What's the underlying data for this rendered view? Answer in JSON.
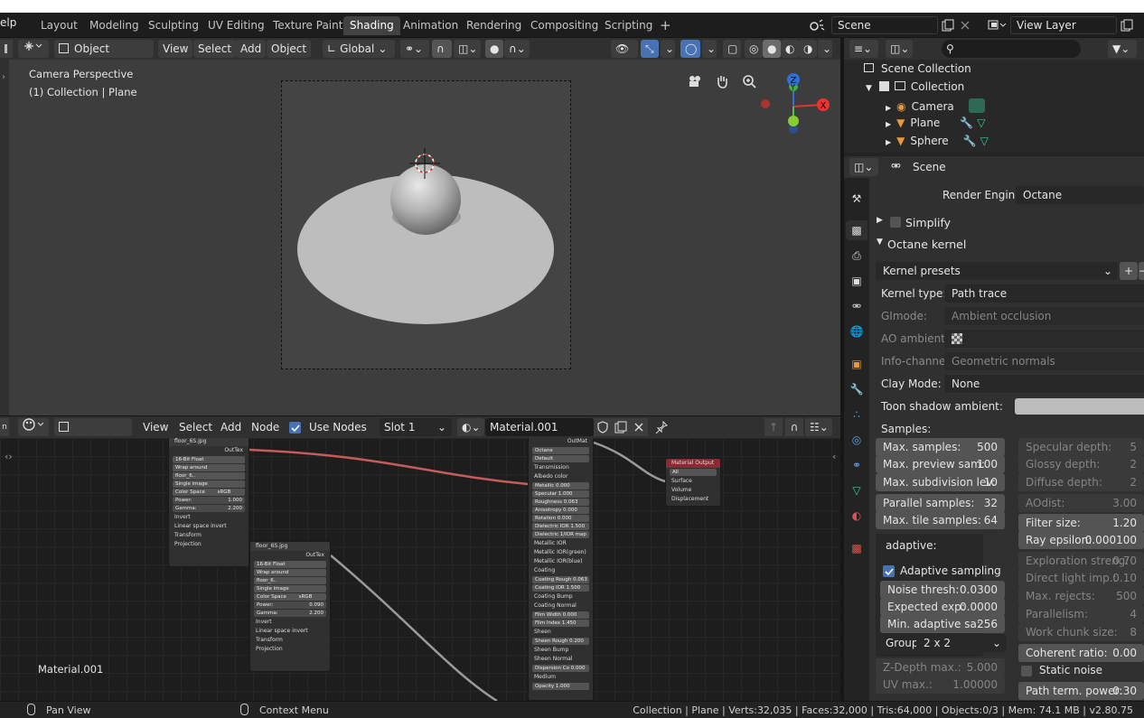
{
  "top_menu": {
    "help_fragment": "elp"
  },
  "workspace_tabs": [
    {
      "label": "Layout"
    },
    {
      "label": "Modeling"
    },
    {
      "label": "Sculpting"
    },
    {
      "label": "UV Editing"
    },
    {
      "label": "Texture Paint"
    },
    {
      "label": "Shading",
      "active": true
    },
    {
      "label": "Animation"
    },
    {
      "label": "Rendering"
    },
    {
      "label": "Compositing"
    },
    {
      "label": "Scripting"
    }
  ],
  "add_tab": "+",
  "scene_selector": {
    "value": "Scene"
  },
  "view_layer": {
    "value": "View Layer"
  },
  "viewport": {
    "mode": "Object Mode",
    "menus": [
      "View",
      "Select",
      "Add",
      "Object"
    ],
    "transform": "Global",
    "overlay_text_1": "Camera Perspective",
    "overlay_text_2": "(1) Collection | Plane",
    "gizmo_axis_z": "Z",
    "gizmo_axis_y": "Y",
    "gizmo_axis_x": "X"
  },
  "node_editor": {
    "type": "Object",
    "menus": [
      "View",
      "Select",
      "Add",
      "Node"
    ],
    "use_nodes_label": "Use Nodes",
    "use_nodes_checked": true,
    "slot": "Slot 1",
    "material": "Material.001",
    "material_label": "Material.001",
    "node1": {
      "title": "floor_6S.jpg",
      "out": "OutTex",
      "rows": [
        "16-Bit Float",
        "Wrap around",
        "floor_6..",
        "Single image",
        "Color Space",
        "sRGB",
        "Power:",
        "1.000",
        "Gamma:",
        "2.200",
        "Invert",
        "Linear space invert",
        "Transform",
        "Projection"
      ]
    },
    "node2": {
      "title": "floor_6S.jpg",
      "out": "OutTex",
      "rows": [
        "16-Bit Float",
        "Wrap around",
        "floor_6..",
        "Single image",
        "Color Space",
        "sRGB",
        "Power:",
        "0.090",
        "Gamma:",
        "2.200",
        "Invert",
        "Linear space invert",
        "Transform",
        "Projection"
      ]
    },
    "node3": {
      "out": "OutMat",
      "rows": [
        "Octane",
        "Default",
        "Transmission",
        "Albedo color",
        "Metallic 0.000",
        "Specular 1.000",
        "Roughness 0.063",
        "Anisotropy 0.000",
        "Rotation 0.000",
        "Dielectric IOR 1.500",
        "Dielectric 1/IOR map",
        "Metallic IOR",
        "Metallic IOR(green)",
        "Metallic IOR(blue)",
        "Coating",
        "Coating Rough 0.063",
        "Coating IOR 1.500",
        "Coating Bump",
        "Coating Normal",
        "Film Width 0.000",
        "Film Index 1.450",
        "Sheen",
        "Sheen Rough 0.200",
        "Sheen Bump",
        "Sheen Normal",
        "Dispersion Co 0.000",
        "Medium",
        "Opacity 1.000"
      ]
    },
    "node4": {
      "title": "Material Output",
      "rows": [
        "All",
        "Surface",
        "Volume",
        "Displacement"
      ]
    }
  },
  "outliner": {
    "root": "Scene Collection",
    "collection": "Collection",
    "items": [
      {
        "label": "Camera"
      },
      {
        "label": "Plane"
      },
      {
        "label": "Sphere"
      }
    ]
  },
  "properties": {
    "context": "Scene",
    "render_engine_label": "Render Engine",
    "render_engine": "Octane",
    "simplify": "Simplify",
    "octane_kernel": "Octane kernel",
    "kernel_presets": "Kernel presets",
    "kernel_type_label": "Kernel type:",
    "kernel_type": "Path trace",
    "gimode_label": "GImode:",
    "gimode": "Ambient occlusion",
    "ao_ambient_label": "AO ambient ..",
    "info_channel_label": "Info-channel..",
    "info_channel": "Geometric normals",
    "clay_mode_label": "Clay Mode:",
    "clay_mode": "None",
    "toon_shadow_label": "Toon shadow ambient:",
    "samples_label": "Samples:",
    "left_fields": [
      {
        "label": "Max. samples:",
        "value": "500"
      },
      {
        "label": "Max. preview sam:",
        "value": "100"
      },
      {
        "label": "Max. subdivision lev:",
        "value": "10"
      },
      {
        "label": "Parallel samples:",
        "value": "32"
      },
      {
        "label": "Max. tile samples:",
        "value": "64"
      }
    ],
    "right_fields": [
      {
        "label": "Specular depth:",
        "value": "5"
      },
      {
        "label": "Glossy depth:",
        "value": "2"
      },
      {
        "label": "Diffuse depth:",
        "value": "2"
      },
      {
        "label": "AOdist:",
        "value": "3.00"
      },
      {
        "label": "Filter size:",
        "value": "1.20"
      },
      {
        "label": "Ray epsilon:",
        "value": "0.000100"
      },
      {
        "label": "Exploration streng:",
        "value": "0.70"
      },
      {
        "label": "Direct light imp.:",
        "value": "0.10"
      },
      {
        "label": "Max. rejects:",
        "value": "500"
      },
      {
        "label": "Parallelism:",
        "value": "4"
      },
      {
        "label": "Work chunk size:",
        "value": "8"
      },
      {
        "label": "Coherent ratio:",
        "value": "0.00"
      },
      {
        "label": "Static noise",
        "value": ""
      },
      {
        "label": "Path term. power:",
        "value": "0.30"
      }
    ],
    "adaptive_label": "adaptive:",
    "adaptive_sampling": "Adaptive sampling",
    "adaptive_fields": [
      {
        "label": "Noise thresh:",
        "value": "0.0300"
      },
      {
        "label": "Expected exp:",
        "value": "0.0000"
      },
      {
        "label": "Min. adaptive sa:",
        "value": "256"
      }
    ],
    "group_label": "Group",
    "group_value": "2 x 2",
    "zdepth": {
      "label": "Z-Depth max.:",
      "value": "5.000"
    },
    "uvmax": {
      "label": "UV max.:",
      "value": "1.00000"
    }
  },
  "statusbar": {
    "left": "Pan View",
    "middle": "Context Menu",
    "right": "Collection | Plane | Verts:32,035 | Faces:32,000 | Tris:64,000 | Objects:0/3 | Mem: 74.1 MB | v2.80.75"
  }
}
